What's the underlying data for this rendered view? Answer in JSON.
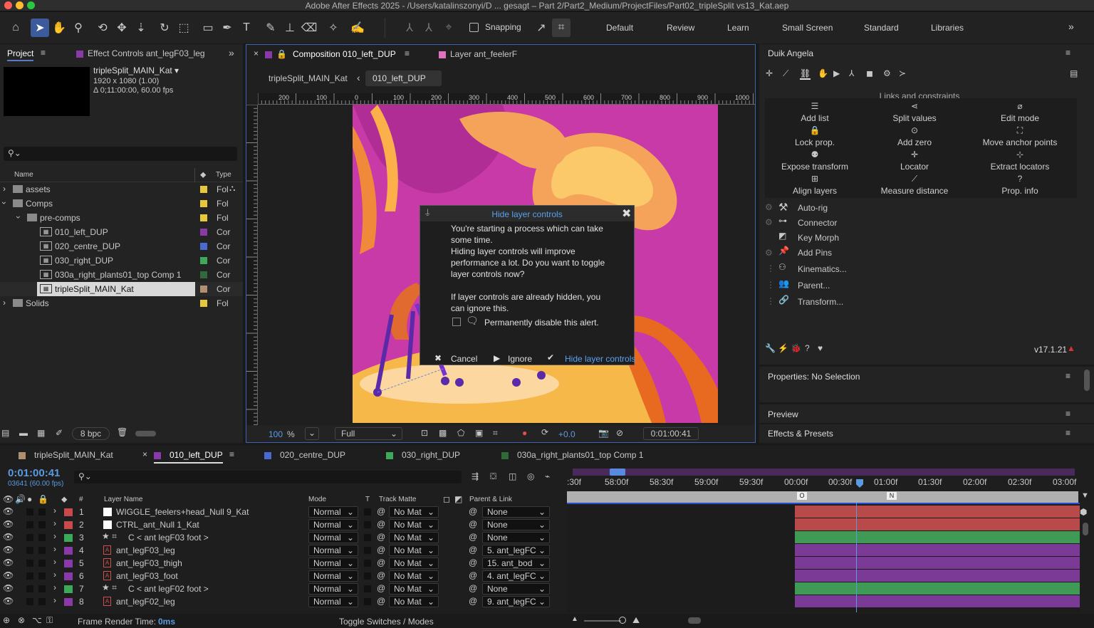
{
  "window": {
    "title": "Adobe After Effects 2025 - /Users/katalinszonyi/D ... gesagt – Part 2/Part2_Medium/ProjectFiles/Part02_tripleSplit vs13_Kat.aep"
  },
  "toolbar": {
    "snapping_label": "Snapping",
    "workspaces": [
      "Default",
      "Review",
      "Learn",
      "Small Screen",
      "Standard",
      "Libraries"
    ]
  },
  "project_panel": {
    "tab_project": "Project",
    "tab_effect_controls": "Effect Controls ant_legF03_leg",
    "item_name": "tripleSplit_MAIN_Kat ▾",
    "item_size": "1920 x 1080 (1.00)",
    "item_duration": "Δ 0;11:00:00, 60.00 fps",
    "search_placeholder": "",
    "col_name": "Name",
    "col_type": "Type",
    "rows": [
      {
        "label": "assets",
        "type": "Fol"
      },
      {
        "label": "Comps",
        "type": "Fol"
      },
      {
        "label": "pre-comps",
        "type": "Fol"
      },
      {
        "label": "010_left_DUP",
        "type": "Cor"
      },
      {
        "label": "020_centre_DUP",
        "type": "Cor"
      },
      {
        "label": "030_right_DUP",
        "type": "Cor"
      },
      {
        "label": "030a_right_plants01_top Comp 1",
        "type": "Cor"
      },
      {
        "label": "tripleSplit_MAIN_Kat",
        "type": "Cor"
      },
      {
        "label": "Solids",
        "type": "Fol"
      }
    ],
    "bpc": "8 bpc"
  },
  "composition_panel": {
    "tab_comp": "Composition 010_left_DUP",
    "tab_layer": "Layer ant_feelerF",
    "crumb_parent": "tripleSplit_MAIN_Kat",
    "crumb_current": "010_left_DUP",
    "ruler_labels": [
      "200",
      "100",
      "0",
      "100",
      "200",
      "300",
      "400",
      "500",
      "600",
      "700",
      "800",
      "900",
      "1000"
    ],
    "zoom": "100",
    "zoom_unit": "%",
    "resolution": "Full",
    "exposure": "+0.0",
    "timecode": "0:01:00:41"
  },
  "dialog": {
    "title": "Hide layer controls",
    "body1": "You're starting a process which can take some time.",
    "body2": "Hiding layer controls will improve performance a lot. Do you want to toggle layer controls now?",
    "body3": "If layer controls are already hidden, you can ignore this.",
    "checkbox_label": "Permanently disable this alert.",
    "cancel": "Cancel",
    "ignore": "Ignore",
    "confirm": "Hide layer controls"
  },
  "duik_panel": {
    "title": "Duik Angela",
    "section": "Links and constraints",
    "grid": [
      {
        "label": "Add list",
        "icon": "list-icon"
      },
      {
        "label": "Split values",
        "icon": "split-icon"
      },
      {
        "label": "Edit mode",
        "icon": "edit-mode-icon"
      },
      {
        "label": "Lock prop.",
        "icon": "lock-icon"
      },
      {
        "label": "Add zero",
        "icon": "zero-icon"
      },
      {
        "label": "Move anchor points",
        "icon": "anchor-icon"
      },
      {
        "label": "Expose transform",
        "icon": "expose-icon"
      },
      {
        "label": "Locator",
        "icon": "locator-icon"
      },
      {
        "label": "Extract locators",
        "icon": "extract-icon"
      },
      {
        "label": "Align layers",
        "icon": "align-icon"
      },
      {
        "label": "Measure distance",
        "icon": "measure-icon"
      },
      {
        "label": "Prop. info",
        "icon": "info-icon"
      }
    ],
    "tools": [
      "Auto-rig",
      "Connector",
      "Key Morph",
      "Add Pins",
      "Kinematics...",
      "Parent...",
      "Transform..."
    ],
    "version": "v17.1.21"
  },
  "properties_panel": {
    "title": "Properties: No Selection"
  },
  "preview_panel": {
    "title": "Preview"
  },
  "effects_panel": {
    "title": "Effects & Presets"
  },
  "timeline": {
    "tabs": [
      "tripleSplit_MAIN_Kat",
      "010_left_DUP",
      "020_centre_DUP",
      "030_right_DUP",
      "030a_right_plants01_top Comp 1"
    ],
    "timecode": "0:01:00:41",
    "frame_info": "03641 (60.00 fps)",
    "col_layer_name": "Layer Name",
    "col_mode": "Mode",
    "col_t": "T",
    "col_track_matte": "Track Matte",
    "col_parent": "Parent & Link",
    "ruler_labels": [
      ":30f",
      "58:00f",
      "58:30f",
      "59:00f",
      "59:30f",
      "00:00f",
      "00:30f",
      "01:00f",
      "01:30f",
      "02:00f",
      "02:30f",
      "03:00f"
    ],
    "marker_o": "O",
    "marker_n": "N",
    "layers": [
      {
        "num": "1",
        "name": "WIGGLE_feelers+head_Null 9_Kat",
        "mode": "Normal",
        "matte": "No Mat",
        "parent": "None",
        "color": "#c94a4a",
        "bar": "#b94a4a"
      },
      {
        "num": "2",
        "name": "CTRL_ant_Null 1_Kat",
        "mode": "Normal",
        "matte": "No Mat",
        "parent": "None",
        "color": "#c94a4a",
        "bar": "#b94a4a"
      },
      {
        "num": "3",
        "name": "C < ant legF03 foot >",
        "mode": "Normal",
        "matte": "No Mat",
        "parent": "None",
        "color": "#3daa5a",
        "bar": "#3f9a55"
      },
      {
        "num": "4",
        "name": "ant_legF03_leg",
        "mode": "Normal",
        "matte": "No Mat",
        "parent": "5. ant_legFC",
        "color": "#8a3aa8",
        "bar": "#7a3a96"
      },
      {
        "num": "5",
        "name": "ant_legF03_thigh",
        "mode": "Normal",
        "matte": "No Mat",
        "parent": "15. ant_bod",
        "color": "#8a3aa8",
        "bar": "#7a3a96"
      },
      {
        "num": "6",
        "name": "ant_legF03_foot",
        "mode": "Normal",
        "matte": "No Mat",
        "parent": "4. ant_legFC",
        "color": "#8a3aa8",
        "bar": "#7a3a96"
      },
      {
        "num": "7",
        "name": "C < ant legF02 foot >",
        "mode": "Normal",
        "matte": "No Mat",
        "parent": "None",
        "color": "#3daa5a",
        "bar": "#3f9a55"
      },
      {
        "num": "8",
        "name": "ant_legF02_leg",
        "mode": "Normal",
        "matte": "No Mat",
        "parent": "9. ant_legFC",
        "color": "#8a3aa8",
        "bar": "#7a3a96"
      }
    ],
    "footer_render_label": "Frame Render Time:",
    "footer_render_value": "0ms",
    "footer_toggle": "Toggle Switches / Modes"
  }
}
